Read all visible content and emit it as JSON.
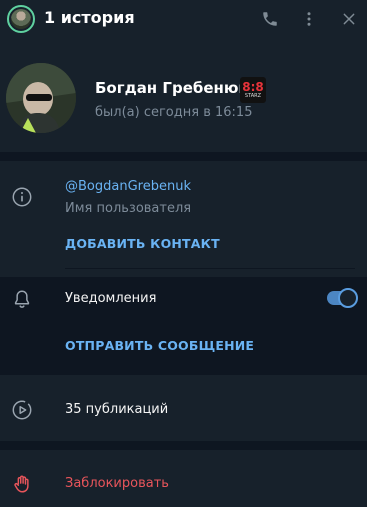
{
  "header": {
    "title": "1 история"
  },
  "profile": {
    "name": "Богдан Гребенюк",
    "status": "был(а) сегодня в 16:15",
    "badge_big": "8:8",
    "badge_small": "STARZ"
  },
  "info": {
    "username": "@BogdanGrebenuk",
    "username_label": "Имя пользователя",
    "add_contact": "ДОБАВИТЬ КОНТАКТ"
  },
  "notifications": {
    "label": "Уведомления",
    "enabled": true,
    "send_message": "ОТПРАВИТЬ СООБЩЕНИЕ"
  },
  "media": {
    "publications": "35 публикаций"
  },
  "block": {
    "label": "Заблокировать"
  },
  "colors": {
    "accent": "#6ab3f3",
    "danger": "#e8555b",
    "panel": "#17212b",
    "background": "#0e1621"
  }
}
